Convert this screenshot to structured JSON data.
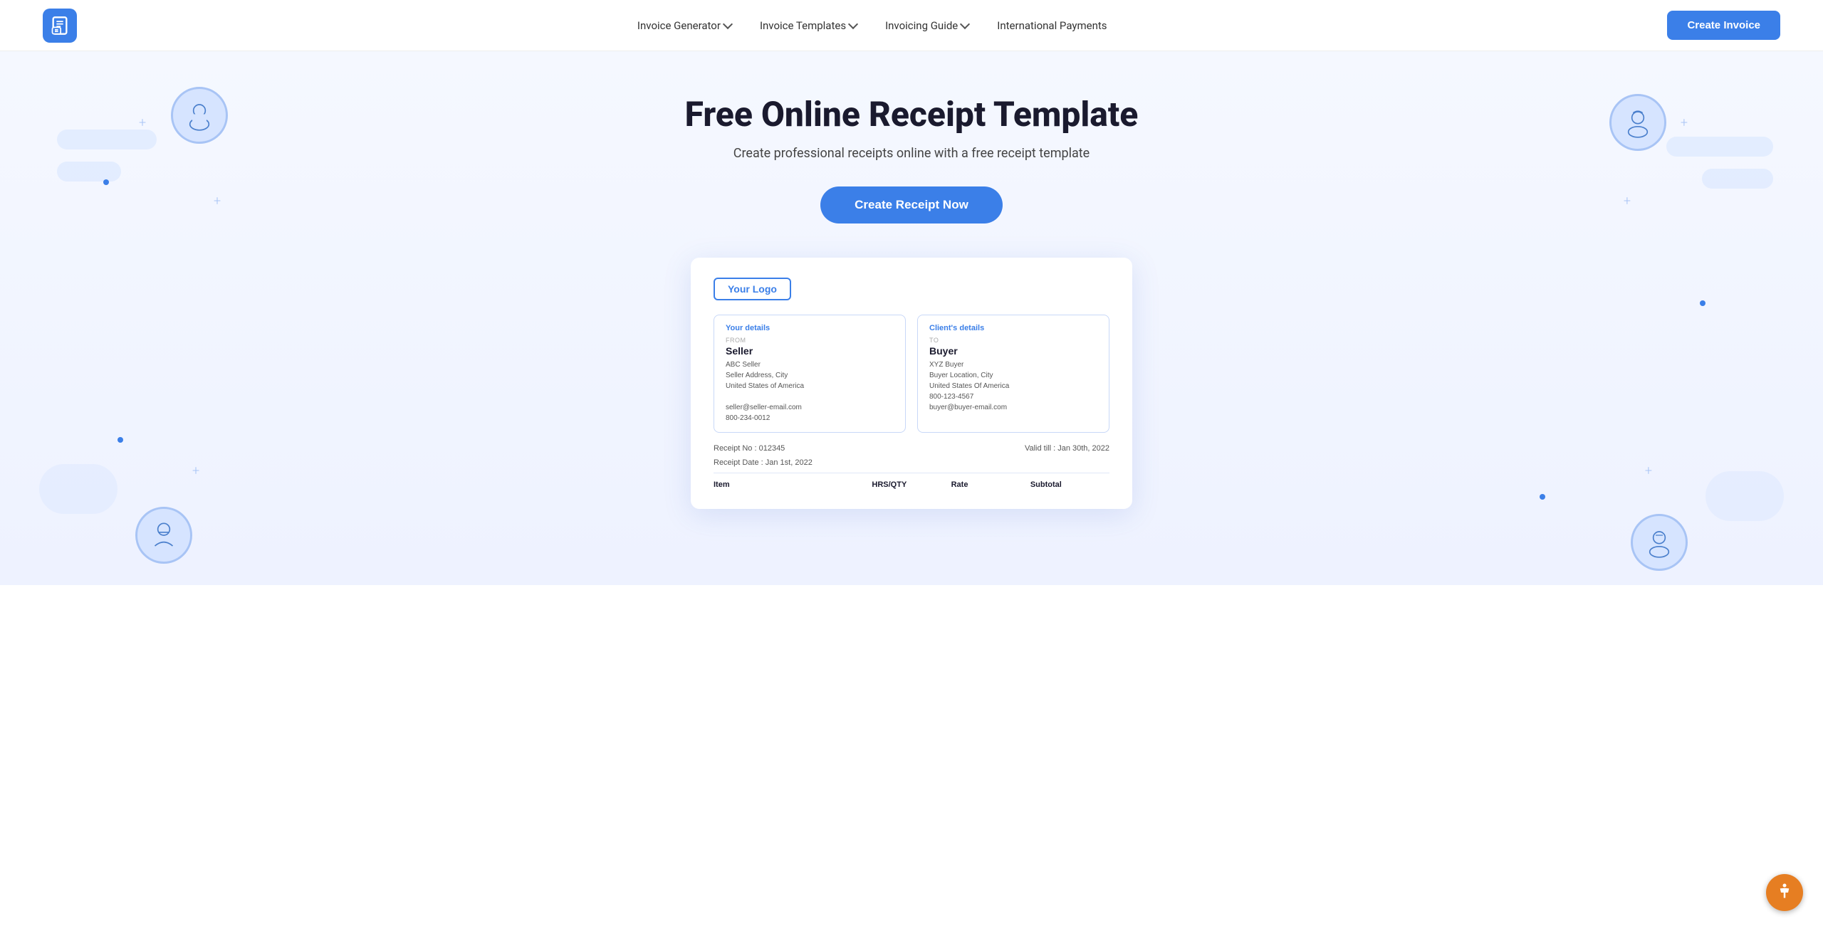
{
  "navbar": {
    "logo_alt": "Invoice Home Logo",
    "nav1_label": "Invoice Generator",
    "nav2_label": "Invoice Templates",
    "nav3_label": "Invoicing Guide",
    "nav4_label": "International Payments",
    "cta_label": "Create Invoice"
  },
  "hero": {
    "title": "Free Online Receipt Template",
    "subtitle": "Create professional receipts online with a free receipt template",
    "cta_label": "Create Receipt Now"
  },
  "receipt": {
    "logo_text": "Your Logo",
    "your_details_title": "Your details",
    "from_label": "FROM",
    "seller_name": "Seller",
    "seller_company": "ABC Seller",
    "seller_address": "Seller Address, City",
    "seller_state": "United States of America",
    "seller_email": "seller@seller-email.com",
    "seller_phone": "800-234-0012",
    "client_details_title": "Client's details",
    "to_label": "TO",
    "buyer_name": "Buyer",
    "buyer_company": "XYZ Buyer",
    "buyer_address": "Buyer Location, City",
    "buyer_state": "United States Of America",
    "buyer_phone": "800-123-4567",
    "buyer_email": "buyer@buyer-email.com",
    "receipt_no_label": "Receipt No :",
    "receipt_no_value": "012345",
    "valid_till_label": "Valid till :",
    "valid_till_value": "Jan 30th, 2022",
    "receipt_date_label": "Receipt Date :",
    "receipt_date_value": "Jan 1st, 2022",
    "col_item": "Item",
    "col_hrs_qty": "HRS/QTY",
    "col_rate": "Rate",
    "col_subtotal": "Subtotal"
  }
}
